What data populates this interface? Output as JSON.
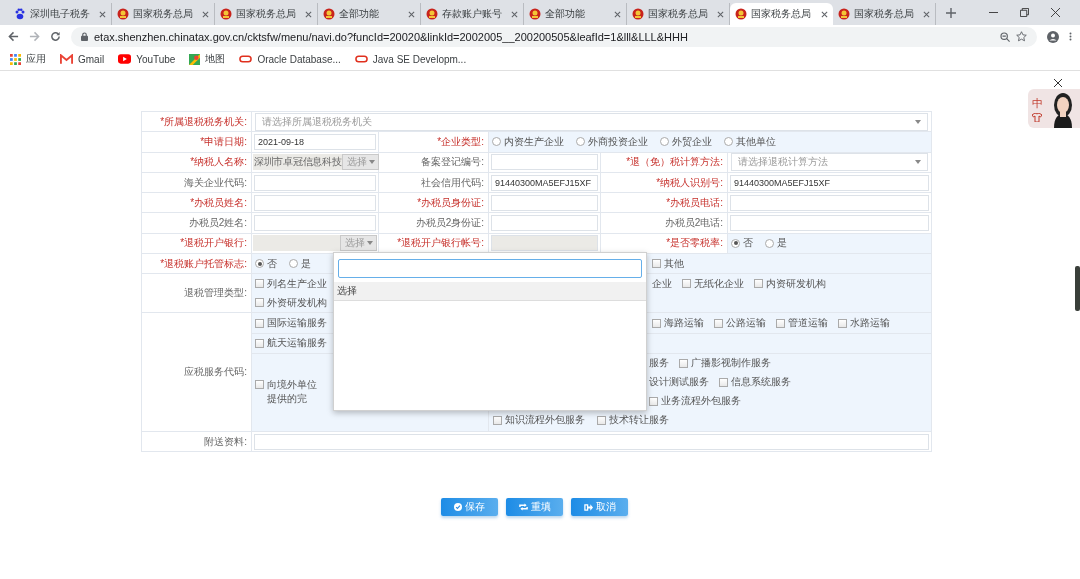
{
  "browser": {
    "tabs": [
      {
        "title": "深圳电子税务",
        "kind": "paw",
        "selected": false
      },
      {
        "title": "国家税务总局",
        "kind": "emblem",
        "selected": false
      },
      {
        "title": "国家税务总局",
        "kind": "emblem",
        "selected": false
      },
      {
        "title": "全部功能",
        "kind": "emblem",
        "selected": false
      },
      {
        "title": "存款账户账号",
        "kind": "emblem",
        "selected": false
      },
      {
        "title": "全部功能",
        "kind": "emblem",
        "selected": false
      },
      {
        "title": "国家税务总局",
        "kind": "emblem",
        "selected": false
      },
      {
        "title": "国家税务总局",
        "kind": "emblem",
        "selected": true
      },
      {
        "title": "国家税务总局",
        "kind": "emblem",
        "selected": false
      }
    ],
    "url": "etax.shenzhen.chinatax.gov.cn/cktsfw/menu/navi.do?funcId=20020&linkId=2002005__200200505&leafId=1&lll&LLL&HHH",
    "bookmarks": [
      {
        "label": "应用",
        "kind": "apps"
      },
      {
        "label": "Gmail",
        "kind": "gmail"
      },
      {
        "label": "YouTube",
        "kind": "youtube"
      },
      {
        "label": "地图",
        "kind": "maps"
      },
      {
        "label": "Oracle Database...",
        "kind": "oracle"
      },
      {
        "label": "Java SE Developm...",
        "kind": "oracle"
      }
    ]
  },
  "form": {
    "rows": [
      {
        "cells": [
          {
            "kind": "label",
            "text": "*所属退税税务机关:",
            "required": true
          },
          {
            "kind": "select",
            "placeholder": "请选择所属退税税务机关"
          }
        ]
      },
      {
        "cells": [
          {
            "kind": "label",
            "text": "*申请日期:",
            "required": true
          },
          {
            "kind": "input",
            "value": "2021-09-18"
          },
          {
            "kind": "label",
            "text": "*企业类型:",
            "required": true
          },
          {
            "kind": "choices",
            "lines": [
              {
                "left": [
                  {
                    "kind": "radio",
                    "label": "内资生产企业",
                    "selected": false
                  },
                  {
                    "kind": "radio",
                    "label": "外商投资企业",
                    "selected": false
                  },
                  {
                    "kind": "radio",
                    "label": "外贸企业",
                    "selected": false
                  },
                  {
                    "kind": "radio",
                    "label": "其他单位",
                    "selected": false
                  }
                ]
              }
            ]
          }
        ]
      },
      {
        "cells": [
          {
            "kind": "label",
            "text": "*纳税人名称:",
            "required": true
          },
          {
            "kind": "picker",
            "value": "深圳市卓冠信息科技",
            "button": "选择"
          },
          {
            "kind": "label",
            "text": "备案登记编号:",
            "required": false
          },
          {
            "kind": "input"
          },
          {
            "kind": "label",
            "text": "*退（免）税计算方法:",
            "required": true
          },
          {
            "kind": "select",
            "placeholder": "请选择退税计算方法"
          }
        ]
      },
      {
        "cells": [
          {
            "kind": "label",
            "text": "海关企业代码:",
            "required": false
          },
          {
            "kind": "input"
          },
          {
            "kind": "label",
            "text": "社会信用代码:",
            "required": false
          },
          {
            "kind": "input",
            "value": "91440300MA5EFJ15XF"
          },
          {
            "kind": "label",
            "text": "*纳税人识别号:",
            "required": true
          },
          {
            "kind": "input",
            "value": "91440300MA5EFJ15XF"
          }
        ]
      },
      {
        "cells": [
          {
            "kind": "label",
            "text": "*办税员姓名:",
            "required": true
          },
          {
            "kind": "input"
          },
          {
            "kind": "label",
            "text": "*办税员身份证:",
            "required": true
          },
          {
            "kind": "input"
          },
          {
            "kind": "label",
            "text": "*办税员电话:",
            "required": true
          },
          {
            "kind": "input"
          }
        ]
      },
      {
        "cells": [
          {
            "kind": "label",
            "text": "办税员2姓名:",
            "required": false
          },
          {
            "kind": "input"
          },
          {
            "kind": "label",
            "text": "办税员2身份证:",
            "required": false
          },
          {
            "kind": "input"
          },
          {
            "kind": "label",
            "text": "办税员2电话:",
            "required": false
          },
          {
            "kind": "input"
          }
        ]
      },
      {
        "cells": [
          {
            "kind": "label",
            "text": "*退税开户银行:",
            "required": true
          },
          {
            "kind": "picker",
            "button": "选择"
          },
          {
            "kind": "label",
            "text": "*退税开户银行帐号:",
            "required": true
          },
          {
            "kind": "input",
            "disabled": true
          },
          {
            "kind": "label",
            "text": "*是否零税率:",
            "required": true
          },
          {
            "kind": "choices",
            "lines": [
              {
                "left": [
                  {
                    "kind": "radio",
                    "label": "否",
                    "selected": true
                  },
                  {
                    "kind": "radio",
                    "label": "是",
                    "selected": false
                  }
                ]
              }
            ]
          }
        ]
      },
      {
        "cells": [
          {
            "kind": "label",
            "text": "*退税账户托管标志:",
            "required": true
          },
          {
            "kind": "choices",
            "lines": [
              {
                "left": [
                  {
                    "kind": "radio",
                    "label": "否",
                    "selected": true
                  },
                  {
                    "kind": "radio",
                    "label": "是",
                    "selected": false
                  }
                ],
                "right": [
                  {
                    "kind": "checkbox",
                    "label": "其他",
                    "checked": false
                  }
                ]
              }
            ]
          }
        ]
      },
      {
        "label": {
          "text": "退税管理类型:",
          "required": false
        },
        "parts": [
          {
            "kind": "choices",
            "lines": [
              {
                "left": [
                  {
                    "kind": "checkbox",
                    "label": "列名生产企业",
                    "checked": false
                  }
                ],
                "right": [
                  {
                    "kind": "fragment",
                    "label": "企业"
                  },
                  {
                    "kind": "checkbox",
                    "label": "无纸化企业",
                    "checked": false
                  },
                  {
                    "kind": "checkbox",
                    "label": "内资研发机构",
                    "checked": false
                  }
                ]
              },
              {
                "left": [
                  {
                    "kind": "checkbox",
                    "label": "外资研发机构",
                    "checked": false
                  }
                ]
              }
            ]
          }
        ]
      },
      {
        "label": {
          "text": "应税服务代码:",
          "required": false
        },
        "parts": [
          {
            "kind": "choices",
            "lines": [
              {
                "left": [
                  {
                    "kind": "checkbox",
                    "label": "国际运输服务",
                    "checked": false
                  }
                ],
                "right": [
                  {
                    "kind": "checkbox",
                    "label": "海路运输",
                    "checked": false
                  },
                  {
                    "kind": "checkbox",
                    "label": "公路运输",
                    "checked": false
                  },
                  {
                    "kind": "checkbox",
                    "label": "管道运输",
                    "checked": false
                  },
                  {
                    "kind": "checkbox",
                    "label": "水路运输",
                    "checked": false
                  }
                ]
              }
            ]
          },
          {
            "kind": "choices",
            "lines": [
              {
                "left": [
                  {
                    "kind": "checkbox",
                    "label": "航天运输服务",
                    "checked": false
                  }
                ]
              }
            ]
          },
          {
            "kind": "split",
            "side": [
              {
                "kind": "checkbox",
                "label": "向境外单位提供的完",
                "checked": false
              }
            ],
            "lines": [
              {
                "right": [
                  {
                    "kind": "fragment",
                    "label": "服务"
                  },
                  {
                    "kind": "checkbox",
                    "label": "广播影视制作服务",
                    "checked": false
                  }
                ]
              },
              {
                "right": [
                  {
                    "kind": "fragment",
                    "label": "设计测试服务"
                  },
                  {
                    "kind": "checkbox",
                    "label": "信息系统服务",
                    "checked": false
                  }
                ]
              },
              {
                "right": [
                  {
                    "kind": "checkbox",
                    "label": "业务流程外包服务",
                    "checked": false
                  }
                ]
              },
              {
                "left": [
                  {
                    "kind": "checkbox",
                    "label": "知识流程外包服务",
                    "checked": false
                  },
                  {
                    "kind": "checkbox",
                    "label": "技术转让服务",
                    "checked": false
                  }
                ]
              }
            ]
          }
        ]
      },
      {
        "cells": [
          {
            "kind": "label",
            "text": "附送资料:",
            "required": false
          },
          {
            "kind": "input"
          }
        ]
      }
    ]
  },
  "popup": {
    "options": [
      {
        "label": "选择",
        "selected": true
      }
    ]
  },
  "buttons": [
    {
      "label": "保存",
      "kind": "save"
    },
    {
      "label": "重填",
      "kind": "reset"
    },
    {
      "label": "取消",
      "kind": "cancel"
    }
  ],
  "widget": {
    "title": "中"
  }
}
